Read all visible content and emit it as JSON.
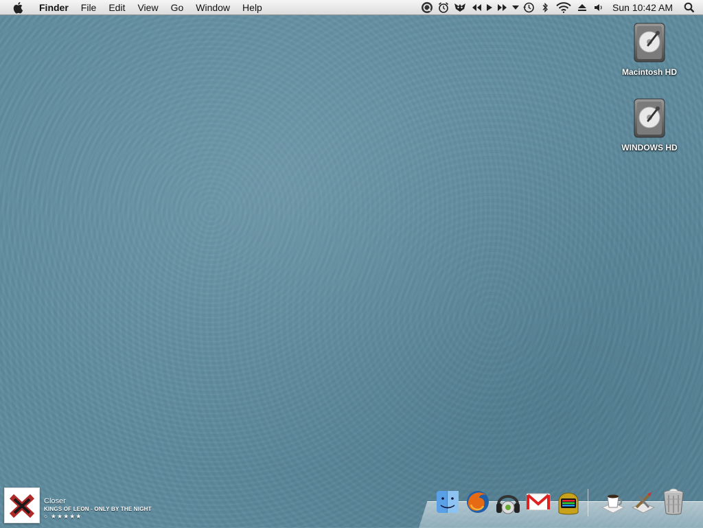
{
  "menubar": {
    "app_name": "Finder",
    "menus": [
      "File",
      "Edit",
      "View",
      "Go",
      "Window",
      "Help"
    ],
    "clock": "Sun 10:42 AM"
  },
  "desktop": {
    "drives": [
      {
        "label": "Macintosh HD"
      },
      {
        "label": "WINDOWS HD"
      }
    ]
  },
  "now_playing": {
    "title": "Closer",
    "artist_album": "KINGS OF LEON - ONLY BY THE NIGHT",
    "rating": "○ ★★★★★"
  },
  "dock": {
    "apps": [
      "finder-icon",
      "firefox-icon",
      "itunes-headphones-icon",
      "gmail-icon",
      "daft-punk-helmet-icon"
    ],
    "right": [
      "coffee-cup-icon",
      "applications-stack-icon",
      "trash-icon"
    ]
  }
}
